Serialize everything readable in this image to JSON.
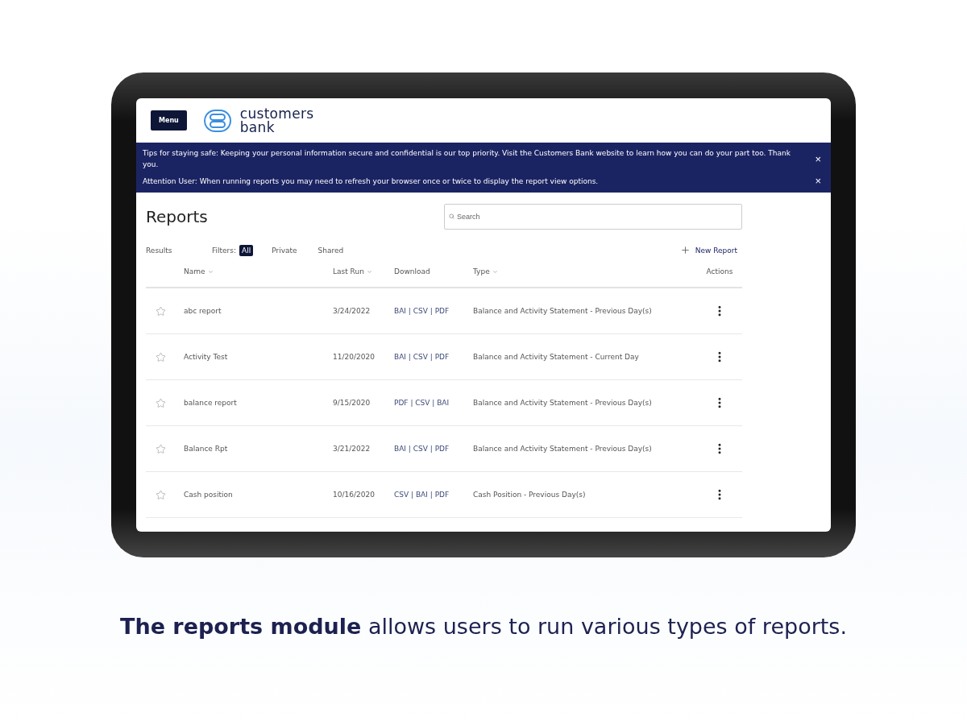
{
  "app": {
    "menu_button": "Menu",
    "logo_text": [
      "customers",
      "bank"
    ]
  },
  "notices": [
    {
      "text": "Tips for staying safe: Keeping your personal information secure and confidential is our top priority. Visit the Customers Bank website to learn how you can do your part too. Thank you.",
      "close": "×"
    },
    {
      "text": "Attention User: When running reports you may need to refresh your browser once or twice to display the report view options.",
      "close": "×"
    }
  ],
  "page": {
    "title": "Reports",
    "search": {
      "placeholder": "Search"
    },
    "results_label": "Results",
    "filters_label": "Filters:",
    "filters": [
      {
        "label": "All",
        "selected": true
      },
      {
        "label": "Private",
        "selected": false
      },
      {
        "label": "Shared",
        "selected": false
      }
    ],
    "new_report": "New Report"
  },
  "table": {
    "columns": [
      {
        "label": "Name",
        "sortable": true
      },
      {
        "label": "Last Run",
        "sortable": true
      },
      {
        "label": "Download",
        "sortable": false
      },
      {
        "label": "Type",
        "sortable": true
      },
      {
        "label": "Actions",
        "sortable": false
      }
    ],
    "rows": [
      {
        "favorite": false,
        "name": "abc report",
        "last_run": "3/24/2022",
        "download": "BAI | CSV | PDF",
        "type": "Balance and Activity Statement - Previous Day(s)"
      },
      {
        "favorite": false,
        "name": "Activity Test",
        "last_run": "11/20/2020",
        "download": "BAI | CSV | PDF",
        "type": "Balance and Activity Statement - Current Day"
      },
      {
        "favorite": false,
        "name": "balance report",
        "last_run": "9/15/2020",
        "download": "PDF | CSV | BAI",
        "type": "Balance and Activity Statement - Previous Day(s)"
      },
      {
        "favorite": false,
        "name": "Balance Rpt",
        "last_run": "3/21/2022",
        "download": "BAI | CSV | PDF",
        "type": "Balance and Activity Statement - Previous Day(s)"
      },
      {
        "favorite": false,
        "name": "Cash position",
        "last_run": "10/16/2020",
        "download": "CSV | BAI | PDF",
        "type": "Cash Position - Previous Day(s)"
      }
    ]
  },
  "caption": "**The reports module** allows users to run various types of reports."
}
